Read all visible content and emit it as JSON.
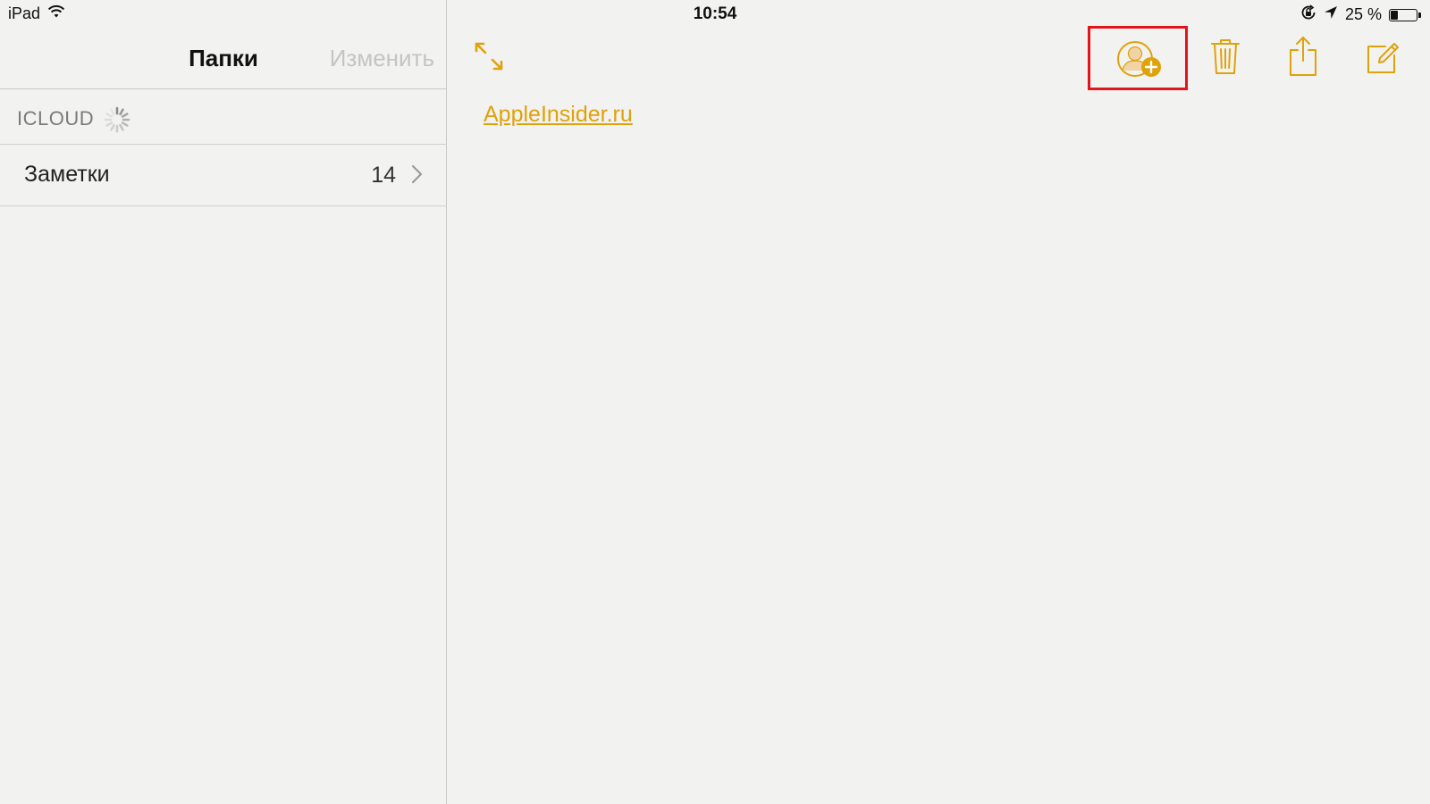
{
  "status_bar": {
    "device": "iPad",
    "time": "10:54",
    "battery": "25 %",
    "battery_level": 0.25
  },
  "sidebar": {
    "title": "Папки",
    "edit_label": "Изменить",
    "section_label": "ICLOUD",
    "folders": [
      {
        "name": "Заметки",
        "count": "14"
      }
    ]
  },
  "note": {
    "link_text": "AppleInsider.ru"
  },
  "colors": {
    "accent": "#e0a20a",
    "highlight": "#e2141c"
  },
  "icons": {
    "expand": "expand-icon",
    "add_person": "add-person-icon",
    "trash": "trash-icon",
    "share": "share-icon",
    "compose": "compose-icon"
  }
}
